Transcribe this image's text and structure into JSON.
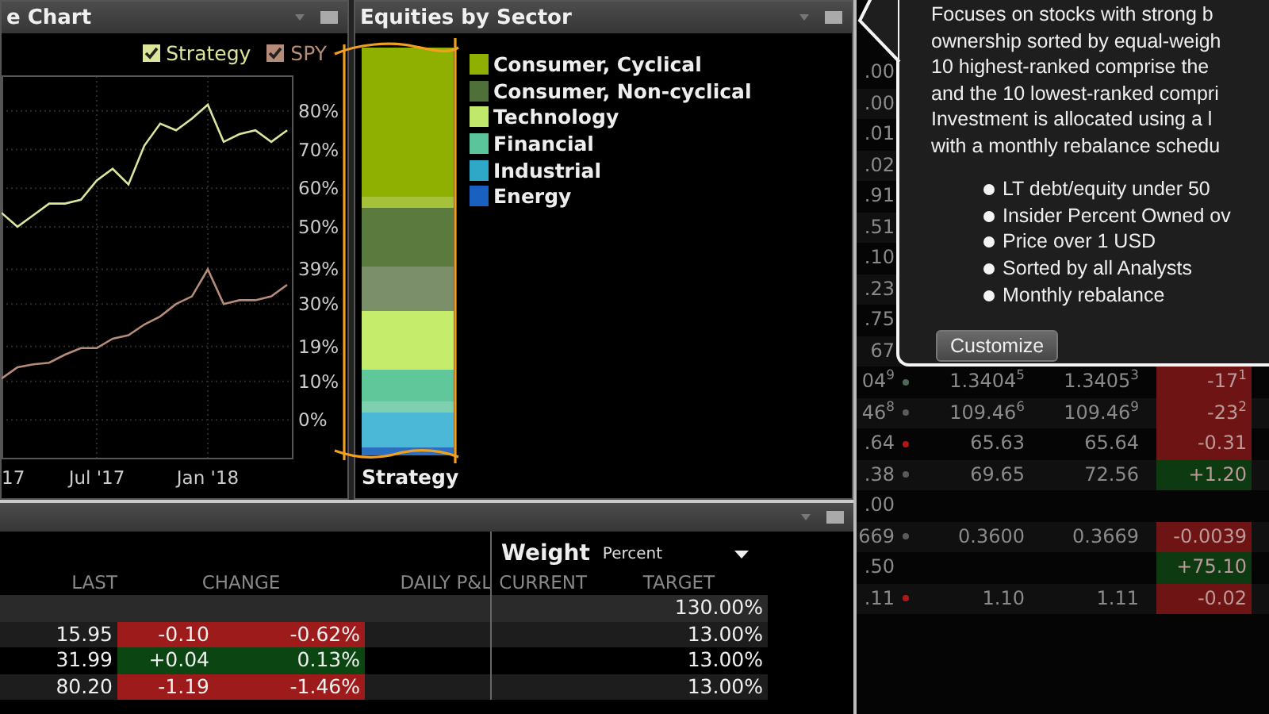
{
  "performance_chart": {
    "title": "e Chart",
    "legend": [
      {
        "checked": true
      },
      {
        "checked": true
      }
    ],
    "chart_data": {
      "type": "line",
      "categories": [
        "17",
        null,
        null,
        null,
        null,
        null,
        "Jul '17",
        null,
        null,
        null,
        null,
        null,
        null,
        "Jan '18",
        null,
        null,
        null,
        null,
        null
      ],
      "series": [
        {
          "name": "Strategy",
          "color": "#dde49c",
          "values": [
            53.6,
            50,
            53,
            56,
            56,
            57,
            62,
            65,
            61,
            71,
            76.7,
            75,
            78,
            81.6,
            72,
            74,
            75,
            72,
            75
          ]
        },
        {
          "name": "SPY",
          "color": "#b48c78",
          "values": [
            10.7,
            13.6,
            14.4,
            14.8,
            16.9,
            18.6,
            18.6,
            21,
            21.9,
            24.7,
            26.8,
            30,
            32,
            39,
            30,
            31,
            31,
            32,
            35
          ]
        }
      ],
      "ylim": [
        -10,
        89
      ],
      "grid": true,
      "yticks": [
        {
          "value": 0,
          "label": "0%"
        },
        {
          "value": 10,
          "label": "10%"
        },
        {
          "value": 19,
          "label": "19%"
        },
        {
          "value": 30,
          "label": "30%"
        },
        {
          "value": 39,
          "label": "39%"
        },
        {
          "value": 50,
          "label": "50%"
        },
        {
          "value": 60,
          "label": "60%"
        },
        {
          "value": 70,
          "label": "70%"
        },
        {
          "value": 80,
          "label": "80%"
        }
      ]
    }
  },
  "sector_panel": {
    "title": "Equities by Sector",
    "bar_label": "Strategy",
    "legend": [
      {
        "label": "Consumer, Cyclical",
        "color": "#8fb000"
      },
      {
        "label": "Consumer, Non-cyclical",
        "color": "#4f7038"
      },
      {
        "label": "Technology",
        "color": "#c0e86a"
      },
      {
        "label": "Financial",
        "color": "#5cc49a"
      },
      {
        "label": "Industrial",
        "color": "#2fa8c8"
      },
      {
        "label": "Energy",
        "color": "#1a60c0"
      }
    ]
  },
  "portfolio_table": {
    "weight_header": "Weight",
    "weight_unit": "Percent",
    "columns": [
      "LAST",
      "CHANGE",
      "DAILY P&L",
      "CURRENT",
      "TARGET"
    ],
    "summary_target": "130.00%",
    "rows": [
      {
        "last": "15.95",
        "change": "-0.10",
        "change_pct": "-0.62%",
        "target": "13.00%",
        "negative": true
      },
      {
        "last": "31.99",
        "change": "+0.04",
        "change_pct": "0.13%",
        "target": "13.00%",
        "negative": false
      },
      {
        "last": "80.20",
        "change": "-1.19",
        "change_pct": "-1.46%",
        "target": "13.00%",
        "negative": true
      }
    ]
  },
  "quote_table": {
    "rows": [
      {
        "column_1": ".00"
      },
      {
        "column_1": ".00"
      },
      {
        "column_1": ".01"
      },
      {
        "column_1": ".02"
      },
      {
        "column_1": ".91"
      },
      {
        "column_1": ".51"
      },
      {
        "column_1": ".10"
      },
      {
        "column_1": ".23"
      },
      {
        "column_1": ".75"
      },
      {
        "column_1": "67"
      },
      {
        "column_1": "04$^{9}$",
        "color": "#4a6a5a",
        "bid": "1.3404$^{5}$",
        "ask": "1.3405$^{3}$",
        "change": "-17$^{1}$",
        "negative": true
      },
      {
        "column_1": "46$^{8}$",
        "color": "#5a5a5a",
        "bid": "109.46$^{6}$",
        "ask": "109.46$^{9}$",
        "change": "-23$^{2}$",
        "negative": true
      },
      {
        "column_1": ".64",
        "color": "#b01818",
        "bid": "65.63",
        "ask": "65.64",
        "change": "-0.31",
        "negative": true
      },
      {
        "column_1": ".38",
        "color": "#5a5a5a",
        "bid": "69.65",
        "ask": "72.56",
        "change": "+1.20",
        "negative": false
      },
      {
        "column_1": ".00"
      },
      {
        "column_1": "669",
        "color": "#5a5a5a",
        "bid": "0.3600",
        "ask": "0.3669",
        "change": "-0.0039",
        "negative": true
      },
      {
        "column_1": ".50",
        "change": "+75.10",
        "negative": false
      },
      {
        "column_1": ".11",
        "color": "#b01818",
        "bid": "1.10",
        "ask": "1.11",
        "change": "-0.02",
        "negative": true
      }
    ]
  },
  "tooltip": {
    "lines": [
      "Focuses on stocks with strong b",
      "ownership sorted by equal-weigh",
      "10 highest-ranked comprise the",
      "and the 10 lowest-ranked compri",
      "Investment is allocated using a l",
      "with a monthly rebalance schedu"
    ],
    "bullets": [
      "LT debt/equity under 50",
      "Insider Percent Owned ov",
      "Price over 1 USD",
      "Sorted by all Analysts",
      "Monthly rebalance"
    ],
    "button": "Customize"
  }
}
